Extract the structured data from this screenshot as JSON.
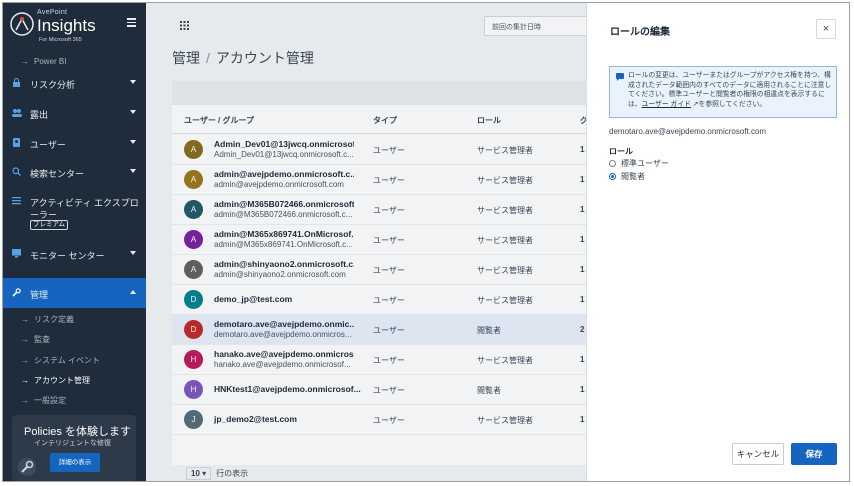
{
  "brand": {
    "company": "AvePoint",
    "product": "Insights",
    "sub": "For Microsoft 365"
  },
  "sidebar": {
    "sub_top": "Power BI",
    "items": [
      {
        "label": "リスク分析",
        "icon": "lock-icon"
      },
      {
        "label": "露出",
        "icon": "users-icon"
      },
      {
        "label": "ユーザー",
        "icon": "user-icon"
      },
      {
        "label": "検索センター",
        "icon": "search-icon"
      },
      {
        "label": "アクティビティ エクスプロ",
        "label2": "ーラー",
        "badge": "プレミアム",
        "icon": "list-icon"
      },
      {
        "label": "モニター センター",
        "icon": "monitor-icon"
      },
      {
        "label": "管理",
        "icon": "wrench-icon"
      }
    ],
    "sub_items": [
      "リスク定義",
      "監査",
      "システム イベント",
      "アカウント管理",
      "一般設定"
    ],
    "promo": {
      "title": "Policies を体験します",
      "subtitle": "インテリジェントな修復",
      "button": "詳細の表示"
    }
  },
  "main": {
    "date_placeholder": "前回の集計日時",
    "breadcrumb": {
      "parent": "管理",
      "sep": "/",
      "current": "アカウント管理"
    },
    "columns": [
      "ユーザー / グループ",
      "タイプ",
      "ロール",
      "グ"
    ],
    "rows": [
      {
        "initial": "A",
        "color": "#8a6d1e",
        "name": "Admin_Dev01@13jwcq.onmicrosof...",
        "email": "Admin_Dev01@13jwcq.onmicrosoft.c...",
        "type": "ユーザー",
        "role": "サービス管理者",
        "num": "1"
      },
      {
        "initial": "A",
        "color": "#9c7a1a",
        "name": "admin@avejpdemo.onmicrosoft.c...",
        "email": "admin@avejpdemo.onmicrosoft.com",
        "type": "ユーザー",
        "role": "サービス管理者",
        "num": "1"
      },
      {
        "initial": "A",
        "color": "#1f5c6b",
        "name": "admin@M365B072466.onmicrosoft...",
        "email": "admin@M365B072466.onmicrosoft.c...",
        "type": "ユーザー",
        "role": "サービス管理者",
        "num": "1"
      },
      {
        "initial": "A",
        "color": "#7b1fa2",
        "name": "admin@M365x869741.OnMicrosof...",
        "email": "admin@M365x869741.OnMicrosoft.c...",
        "type": "ユーザー",
        "role": "サービス管理者",
        "num": "1"
      },
      {
        "initial": "A",
        "color": "#616161",
        "name": "admin@shinyaono2.onmicrosoft.c...",
        "email": "admin@shinyaono2.onmicrosoft.com",
        "type": "ユーザー",
        "role": "サービス管理者",
        "num": "1"
      },
      {
        "initial": "D",
        "color": "#00838f",
        "name": "demo_jp@test.com",
        "email": "",
        "type": "ユーザー",
        "role": "サービス管理者",
        "num": "1"
      },
      {
        "initial": "D",
        "color": "#c62828",
        "name": "demotaro.ave@avejpdemo.onmic...",
        "email": "demotaro.ave@avejpdemo.onmicros...",
        "type": "ユーザー",
        "role": "閲覧者",
        "num": "2",
        "selected": true
      },
      {
        "initial": "H",
        "color": "#c2185b",
        "name": "hanako.ave@avejpdemo.onmicros...",
        "email": "hanako.ave@avejpdemo.onmicrosof...",
        "type": "ユーザー",
        "role": "サービス管理者",
        "num": "1"
      },
      {
        "initial": "H",
        "color": "#7e57c2",
        "name": "HNKtest1@avejpdemo.onmicrosof...",
        "email": "",
        "type": "ユーザー",
        "role": "閲覧者",
        "num": "1"
      },
      {
        "initial": "J",
        "color": "#546e7a",
        "name": "jp_demo2@test.com",
        "email": "",
        "type": "ユーザー",
        "role": "サービス管理者",
        "num": "1"
      }
    ],
    "pager": {
      "size": "10",
      "label": "行の表示"
    }
  },
  "panel": {
    "title": "ロールの編集",
    "close": "×",
    "info": "ロールの変更は、ユーザーまたはグループがアクセス権を持つ、構成されたデータ範囲内のすべてのデータに適用されることに注意してください。標準ユーザーと閲覧者の権限の相違点を表示するには、",
    "info_link": "ユーザー ガイド",
    "info_tail": "を参照してください。",
    "email": "demotaro.ave@avejpdemo.onmicrosoft.com",
    "role_label": "ロール",
    "options": [
      {
        "label": "標準ユーザー",
        "checked": false
      },
      {
        "label": "閲覧者",
        "checked": true
      }
    ],
    "cancel": "キャンセル",
    "save": "保存"
  }
}
